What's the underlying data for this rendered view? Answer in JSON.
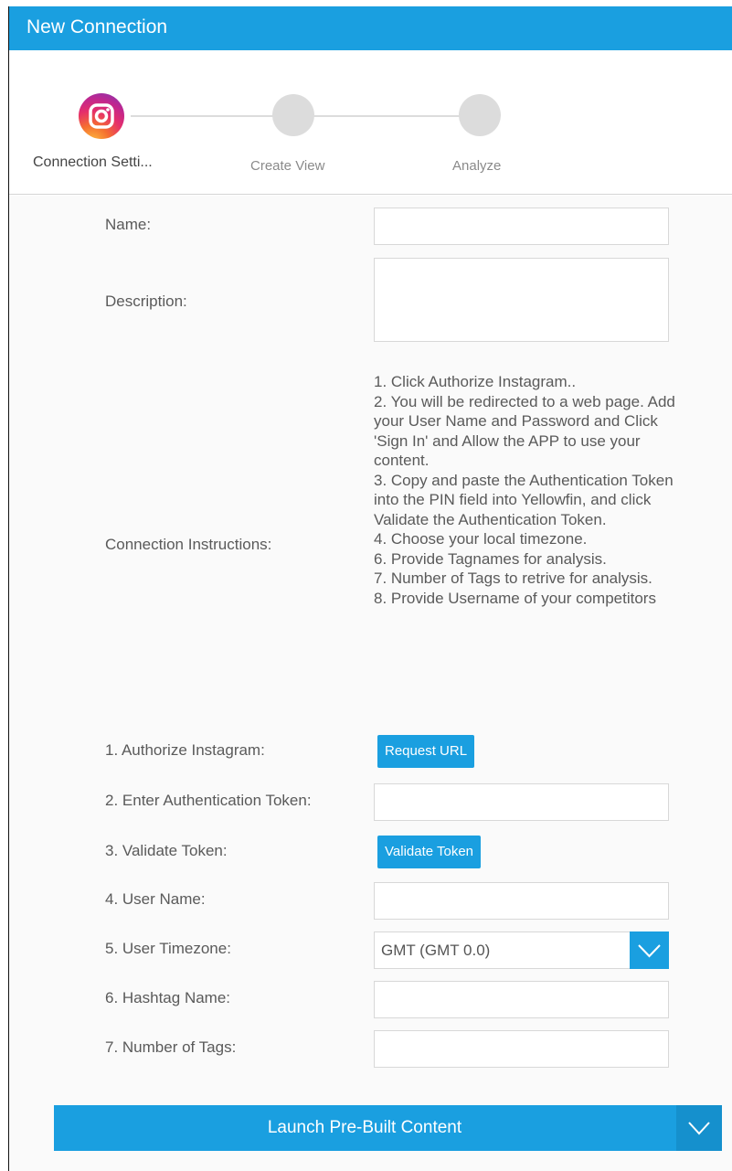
{
  "window": {
    "title": "New Connection"
  },
  "steps": [
    {
      "label": "Connection Setti..."
    },
    {
      "label": "Create View"
    },
    {
      "label": "Analyze"
    }
  ],
  "form": {
    "name_label": "Name:",
    "description_label": "Description:",
    "instructions_label": "Connection Instructions:",
    "instructions": [
      "1. Click Authorize Instagram..",
      "2. You will be redirected to a web page. Add your User Name and Password and Click 'Sign In' and Allow the APP to use your content.",
      "3. Copy and paste the Authentication Token into the PIN field into Yellowfin, and click Validate the Authentication Token.",
      "4. Choose your local timezone.",
      "6. Provide Tagnames for analysis.",
      "7. Number of Tags to retrive for analysis.",
      "8. Provide Username of your competitors"
    ],
    "authorize_label": "1. Authorize Instagram:",
    "request_url_button": "Request URL",
    "auth_token_label": "2. Enter Authentication Token:",
    "validate_label": "3. Validate Token:",
    "validate_button": "Validate Token",
    "username_label": "4. User Name:",
    "timezone_label": "5. User Timezone:",
    "timezone_value": "GMT (GMT 0.0)",
    "hashtag_label": "6. Hashtag Name:",
    "num_tags_label": "7. Number of Tags:"
  },
  "footer": {
    "launch_label": "Launch Pre-Built Content"
  },
  "colors": {
    "accent": "#1a9fe0",
    "step_inactive": "#dcdcdc"
  }
}
